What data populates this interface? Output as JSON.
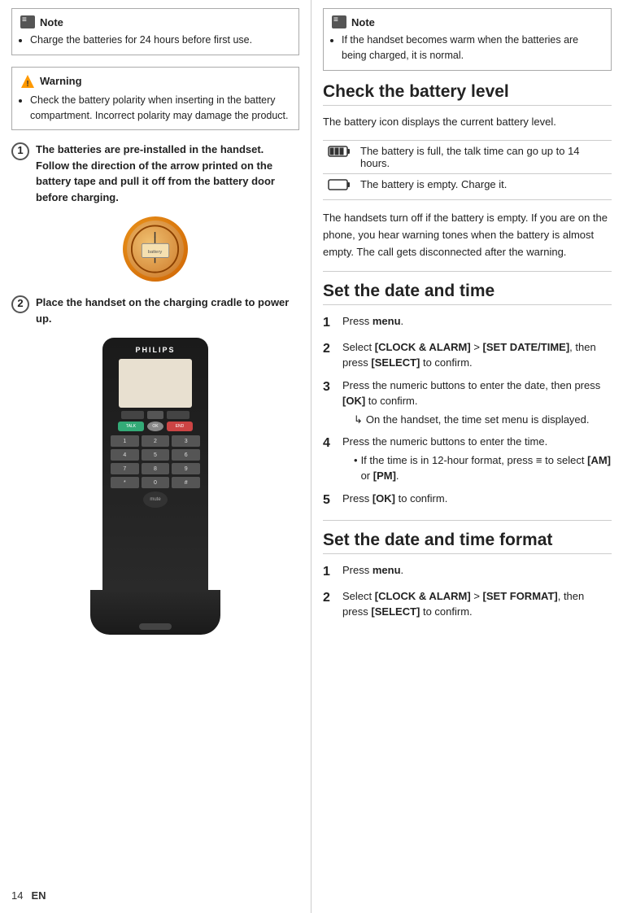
{
  "left_col": {
    "note1": {
      "label": "Note",
      "items": [
        "Charge the batteries for 24 hours before first use."
      ]
    },
    "warning": {
      "label": "Warning",
      "items": [
        "Check the battery polarity when inserting in the battery compartment. Incorrect polarity may damage the product."
      ]
    },
    "step1": {
      "number": "1",
      "text": "The batteries are pre-installed in the handset. Follow the direction of the arrow printed on the battery tape and pull it off from the battery door before charging."
    },
    "step2": {
      "number": "2",
      "text": "Place the handset on the charging cradle to power up."
    },
    "phone_brand": "PHILIPS",
    "phone_talk": "TALK",
    "phone_end": "END",
    "keys": [
      "1",
      "2",
      "3",
      "4",
      "5",
      "6",
      "7",
      "8",
      "9",
      "*",
      "0",
      "#"
    ]
  },
  "right_col": {
    "note2": {
      "label": "Note",
      "items": [
        "If the handset becomes warm when the batteries are being charged, it is normal."
      ]
    },
    "battery_section": {
      "title": "Check the battery level",
      "body": "The battery icon displays the current battery level.",
      "table": [
        {
          "icon": "▪",
          "desc": "The battery is full, the talk time can go up to 14 hours."
        },
        {
          "icon": "□",
          "desc": "The battery is empty. Charge it."
        }
      ],
      "footer": "The handsets turn off if the battery is empty. If you are on the phone, you hear warning tones when the battery is almost empty. The call gets disconnected after the warning."
    },
    "datetime_section": {
      "title": "Set the date and time",
      "steps": [
        {
          "num": "1",
          "text": "Press ",
          "bold": "menu",
          "rest": "."
        },
        {
          "num": "2",
          "text": "Select ",
          "bold": "[CLOCK & ALARM]",
          "mid": " > ",
          "bold2": "[SET DATE/TIME]",
          "rest": ", then press ",
          "bold3": "[SELECT]",
          "rest2": " to confirm."
        },
        {
          "num": "3",
          "text": "Press the numeric buttons to enter the date, then press ",
          "bold": "[OK]",
          "rest": " to confirm.",
          "sub": "On the handset, the time set menu is displayed."
        },
        {
          "num": "4",
          "text": "Press the numeric buttons to enter the time.",
          "bullet": "If the time is in 12-hour format, press",
          "bold_b": "≡",
          "rest_b": " to select ",
          "bold_c": "[AM]",
          "mid_b": " or ",
          "bold_d": "[PM]",
          "rest_c": "."
        },
        {
          "num": "5",
          "text": "Press ",
          "bold": "[OK]",
          "rest": " to confirm."
        }
      ]
    },
    "datetime_format_section": {
      "title": "Set the date and time format",
      "steps": [
        {
          "num": "1",
          "text": "Press ",
          "bold": "menu",
          "rest": "."
        },
        {
          "num": "2",
          "text": "Select ",
          "bold": "[CLOCK & ALARM]",
          "mid": " > ",
          "bold2": "[SET FORMAT]",
          "rest": ", then press ",
          "bold3": "[SELECT]",
          "rest2": " to confirm."
        }
      ]
    }
  },
  "footer": {
    "page_num": "14",
    "lang": "EN"
  }
}
